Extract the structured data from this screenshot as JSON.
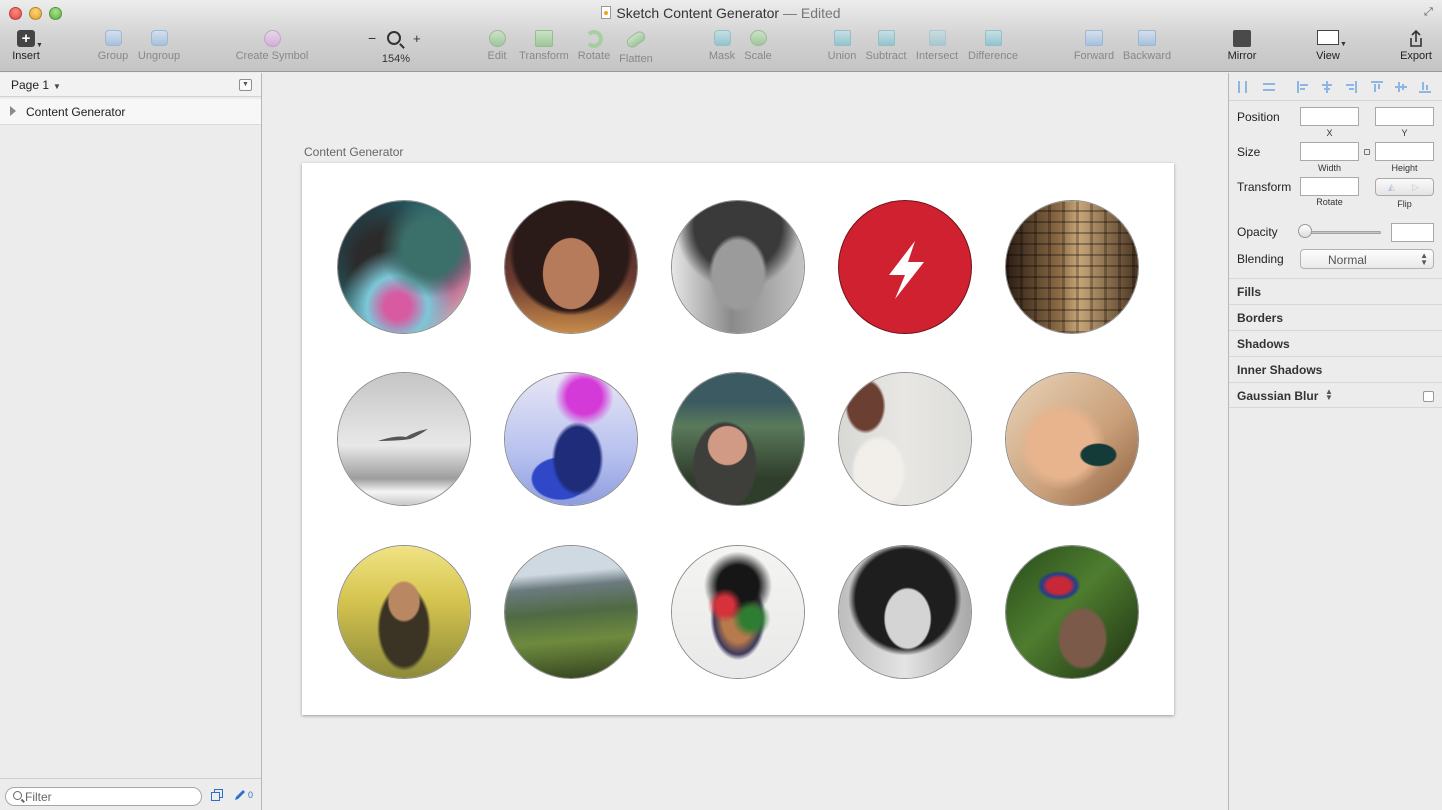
{
  "window": {
    "title": "Sketch Content Generator",
    "edited_suffix": "— Edited"
  },
  "toolbar": {
    "insert": "Insert",
    "group": "Group",
    "ungroup": "Ungroup",
    "create_symbol": "Create Symbol",
    "zoom_minus": "−",
    "zoom_plus": "+",
    "zoom_level": "154%",
    "edit": "Edit",
    "transform": "Transform",
    "rotate": "Rotate",
    "flatten": "Flatten",
    "mask": "Mask",
    "scale": "Scale",
    "union": "Union",
    "subtract": "Subtract",
    "intersect": "Intersect",
    "difference": "Difference",
    "forward": "Forward",
    "backward": "Backward",
    "mirror": "Mirror",
    "view": "View",
    "export": "Export"
  },
  "left_panel": {
    "page_label": "Page 1",
    "layers": [
      {
        "name": "Content Generator"
      }
    ],
    "filter_placeholder": "Filter",
    "edit_count": "0"
  },
  "canvas": {
    "artboard_title": "Content Generator",
    "avatars": [
      {
        "kind": "woman with blue hair smoking"
      },
      {
        "kind": "smiling woman portrait"
      },
      {
        "kind": "black and white man portrait"
      },
      {
        "kind": "red lightning logo"
      },
      {
        "kind": "building fire escapes"
      },
      {
        "kind": "bird flying over sea"
      },
      {
        "kind": "woman with pink hair"
      },
      {
        "kind": "man in hood smiling"
      },
      {
        "kind": "woman with light dress"
      },
      {
        "kind": "baby with pacifier"
      },
      {
        "kind": "woman in golden light"
      },
      {
        "kind": "mountain landscape"
      },
      {
        "kind": "abstract paint face"
      },
      {
        "kind": "woman with glasses smiling"
      },
      {
        "kind": "union jack hat"
      }
    ]
  },
  "inspector": {
    "position_label": "Position",
    "x_label": "X",
    "y_label": "Y",
    "size_label": "Size",
    "width_label": "Width",
    "height_label": "Height",
    "transform_label": "Transform",
    "rotate_label": "Rotate",
    "flip_label": "Flip",
    "opacity_label": "Opacity",
    "opacity_value": "",
    "blending_label": "Blending",
    "blending_value": "Normal",
    "sections": [
      "Fills",
      "Borders",
      "Shadows",
      "Inner Shadows",
      "Gaussian Blur"
    ]
  },
  "colors": {
    "accent_blue": "#2a6fd0",
    "logo_red": "#cf2130"
  }
}
